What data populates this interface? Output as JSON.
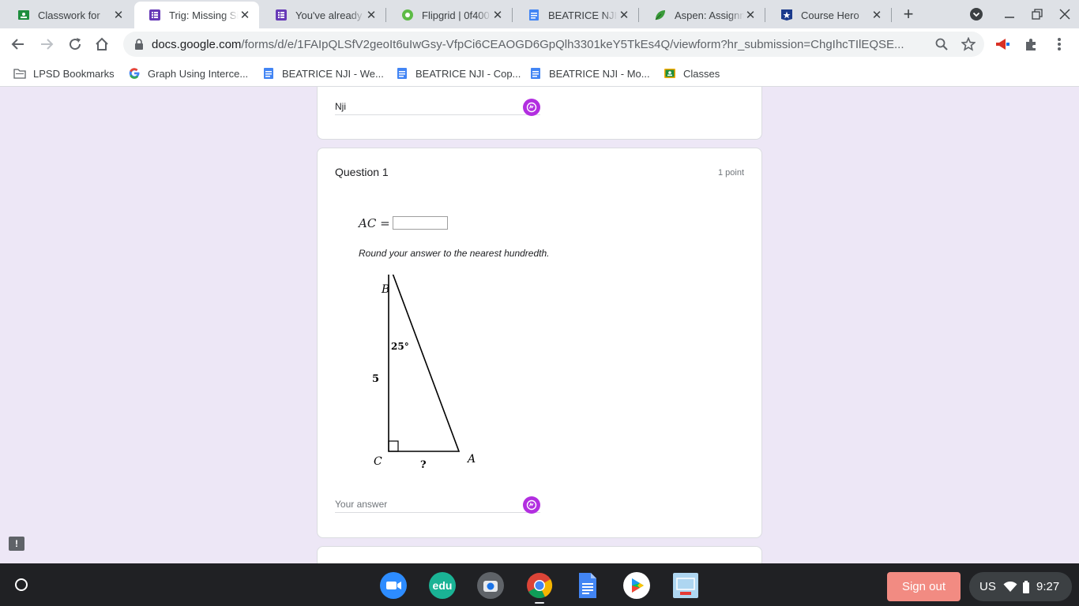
{
  "browser": {
    "tabs": [
      {
        "title": "Classwork for",
        "icon": "google-classroom-icon",
        "active": false
      },
      {
        "title": "Trig: Missing Si",
        "icon": "google-forms-icon",
        "active": true
      },
      {
        "title": "You've already r",
        "icon": "google-forms-icon",
        "active": false
      },
      {
        "title": "Flipgrid | 0f400",
        "icon": "flipgrid-icon",
        "active": false
      },
      {
        "title": "BEATRICE NJI -",
        "icon": "google-docs-icon",
        "active": false
      },
      {
        "title": "Aspen: Assignm",
        "icon": "aspen-icon",
        "active": false
      },
      {
        "title": "Course Hero",
        "icon": "course-hero-icon",
        "active": false
      }
    ],
    "url_host": "docs.google.com",
    "url_path": "/forms/d/e/1FAIpQLSfV2geoIt6uIwGsy-VfpCi6CEAOGD6GpQlh3301keY5TkEs4Q/viewform?hr_submission=ChgIhcTIlEQSE..."
  },
  "bookmarks": [
    {
      "label": "LPSD Bookmarks",
      "icon": "folder-icon"
    },
    {
      "label": "Graph Using Interce...",
      "icon": "google-icon"
    },
    {
      "label": "BEATRICE NJI - We...",
      "icon": "google-docs-icon"
    },
    {
      "label": "BEATRICE NJI - Cop...",
      "icon": "google-docs-icon"
    },
    {
      "label": "BEATRICE NJI - Mo...",
      "icon": "google-docs-icon"
    },
    {
      "label": "Classes",
      "icon": "google-classroom-icon"
    }
  ],
  "form": {
    "prev_answer": "Nji",
    "question_title": "Question 1",
    "question_points": "1 point",
    "ac_label": "AC =",
    "instruction": "Round your answer to the nearest hundredth.",
    "answer_placeholder": "Your answer",
    "figure": {
      "vertex_b": "B",
      "vertex_c": "C",
      "vertex_a": "A",
      "angle_label": "25°",
      "side_bc": "5",
      "side_ca": "?"
    }
  },
  "shelf": {
    "apps": [
      "zoom-icon",
      "edulastic-icon",
      "camera-icon",
      "chrome-icon",
      "google-docs-icon",
      "play-store-icon",
      "screencast-icon"
    ],
    "sign_out_label": "Sign out",
    "keyboard_layout": "US",
    "time": "9:27"
  },
  "colors": {
    "form_bg": "#ede7f6",
    "forms_purple": "#673ab7",
    "grammarly": "#b22ee0",
    "sign_out": "#f28b82"
  }
}
